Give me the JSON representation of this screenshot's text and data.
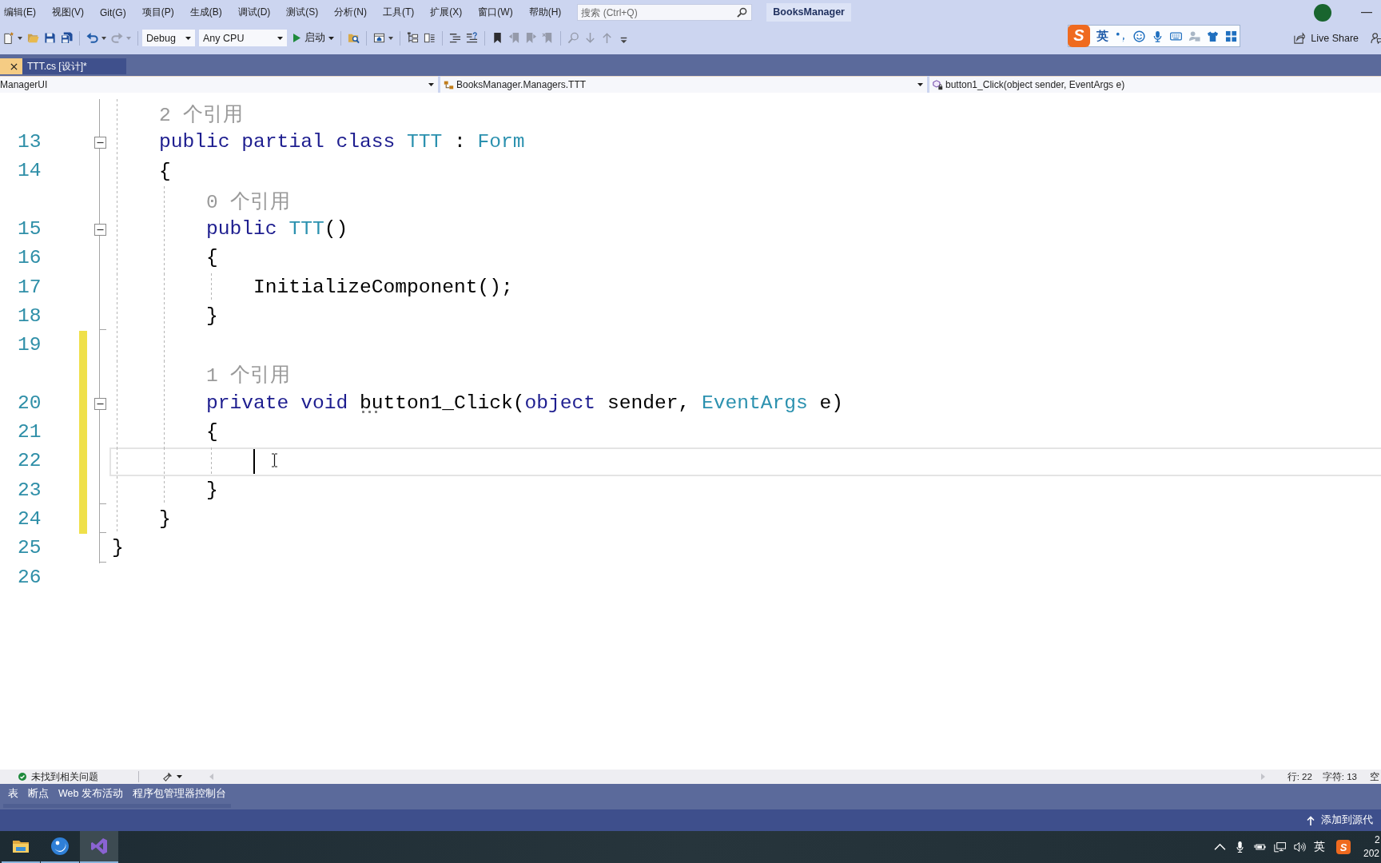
{
  "menu_bar": {
    "items": [
      "编辑(E)",
      "视图(V)",
      "Git(G)",
      "项目(P)",
      "生成(B)",
      "调试(D)",
      "测试(S)",
      "分析(N)",
      "工具(T)",
      "扩展(X)",
      "窗口(W)",
      "帮助(H)"
    ],
    "search": {
      "placeholder": "搜索 (Ctrl+Q)"
    },
    "solution": "BooksManager"
  },
  "toolbar": {
    "groups": [
      [
        {
          "kind": "new",
          "disabled": false
        },
        {
          "kind": "open",
          "disabled": false
        },
        {
          "kind": "save",
          "disabled": false
        },
        {
          "kind": "save_all",
          "disabled": false
        }
      ],
      [
        {
          "kind": "undo",
          "disabled": false
        },
        {
          "kind": "redo",
          "disabled": true
        }
      ],
      [
        {
          "kind": "configuration",
          "value": "Debug"
        },
        {
          "kind": "platform",
          "value": "Any CPU"
        },
        {
          "kind": "start",
          "label": "启动"
        }
      ],
      [
        {
          "kind": "find_in_files",
          "disabled": false
        }
      ],
      [
        {
          "kind": "window",
          "disabled": false
        }
      ],
      [
        {
          "kind": "outline",
          "disabled": false
        },
        {
          "kind": "columns",
          "disabled": false
        }
      ],
      [
        {
          "kind": "comment",
          "disabled": false
        },
        {
          "kind": "uncomment",
          "disabled": false
        }
      ],
      [
        {
          "kind": "bookmark",
          "disabled": false
        },
        {
          "kind": "previous_bookmark",
          "disabled": true
        },
        {
          "kind": "next_bookmark",
          "disabled": true
        },
        {
          "kind": "clear_bookmarks",
          "disabled": true
        }
      ],
      [
        {
          "kind": "find_references",
          "disabled": true
        },
        {
          "kind": "move_down",
          "disabled": true
        },
        {
          "kind": "move_up",
          "disabled": true
        },
        {
          "kind": "overflow",
          "disabled": false
        }
      ]
    ],
    "live_share": "Live Share"
  },
  "ime_toolbar": {
    "logo": "S",
    "mode": "英"
  },
  "tabs": [
    {
      "selected": true
    },
    {
      "label": "TTT.cs [设计]*",
      "selected": false
    }
  ],
  "navigation_bar": {
    "project": "ManagerUI",
    "type": "BooksManager.Managers.TTT",
    "member": "button1_Click(object sender, EventArgs e)"
  },
  "editor": {
    "rows": [
      {
        "kind": "block",
        "children": [
          {
            "kind": "lens",
            "text": "2 个引用",
            "changed": false
          },
          {
            "kind": "code",
            "number": "13",
            "collapsible": true,
            "changed": false,
            "current": false,
            "tokens": [
              {
                "kind": "keyword",
                "text": "public "
              },
              {
                "kind": "keyword",
                "text": "partial "
              },
              {
                "kind": "keyword",
                "text": "class "
              },
              {
                "kind": "type",
                "text": "TTT"
              },
              {
                "kind": "plain",
                "text": " : "
              },
              {
                "kind": "type",
                "text": "Form"
              }
            ]
          },
          {
            "kind": "code",
            "number": "14",
            "collapsible": false,
            "changed": false,
            "current": false,
            "tokens": [
              {
                "kind": "plain",
                "text": "{"
              }
            ]
          },
          {
            "kind": "block",
            "children": [
              {
                "kind": "lens",
                "text": "0 个引用",
                "changed": false
              },
              {
                "kind": "code",
                "number": "15",
                "collapsible": true,
                "changed": false,
                "current": false,
                "tokens": [
                  {
                    "kind": "keyword",
                    "text": "public "
                  },
                  {
                    "kind": "type",
                    "text": "TTT"
                  },
                  {
                    "kind": "plain",
                    "text": "()"
                  }
                ]
              },
              {
                "kind": "code",
                "number": "16",
                "collapsible": false,
                "changed": false,
                "current": false,
                "tokens": [
                  {
                    "kind": "plain",
                    "text": "{"
                  }
                ]
              },
              {
                "kind": "block",
                "children": [
                  {
                    "kind": "code",
                    "number": "17",
                    "collapsible": false,
                    "changed": false,
                    "current": false,
                    "tokens": [
                      {
                        "kind": "plain",
                        "text": "InitializeComponent();"
                      }
                    ]
                  }
                ]
              },
              {
                "kind": "code",
                "number": "18",
                "collapsible": false,
                "changed": false,
                "current": false,
                "tokens": [
                  {
                    "kind": "plain",
                    "text": "}"
                  }
                ]
              },
              {
                "kind": "code",
                "number": "19",
                "collapsible": false,
                "changed": true,
                "current": false
              },
              {
                "kind": "lens",
                "text": "1 个引用",
                "changed": true
              },
              {
                "kind": "code",
                "number": "20",
                "collapsible": true,
                "changed": true,
                "current": false,
                "tokens": [
                  {
                    "kind": "keyword",
                    "text": "private "
                  },
                  {
                    "kind": "keyword",
                    "text": "void "
                  },
                  {
                    "kind": "plain",
                    "text": "button1_Click",
                    "hint": true
                  },
                  {
                    "kind": "plain",
                    "text": "("
                  },
                  {
                    "kind": "keyword",
                    "text": "object "
                  },
                  {
                    "kind": "plain",
                    "text": "sender, "
                  },
                  {
                    "kind": "type",
                    "text": "EventArgs "
                  },
                  {
                    "kind": "plain",
                    "text": "e)"
                  }
                ]
              },
              {
                "kind": "code",
                "number": "21",
                "collapsible": false,
                "changed": true,
                "current": false,
                "tokens": [
                  {
                    "kind": "plain",
                    "text": "{"
                  }
                ]
              },
              {
                "kind": "block",
                "children": [
                  {
                    "kind": "code",
                    "number": "22",
                    "collapsible": false,
                    "changed": true,
                    "current": true
                  }
                ]
              },
              {
                "kind": "code",
                "number": "23",
                "collapsible": false,
                "changed": true,
                "current": false,
                "tokens": [
                  {
                    "kind": "plain",
                    "text": "}"
                  }
                ]
              }
            ]
          },
          {
            "kind": "code",
            "number": "24",
            "collapsible": false,
            "changed": true,
            "current": false,
            "tokens": [
              {
                "kind": "plain",
                "text": "}"
              }
            ]
          }
        ]
      },
      {
        "kind": "code",
        "number": "25",
        "collapsible": false,
        "changed": false,
        "current": false,
        "tokens": [
          {
            "kind": "plain",
            "text": "}"
          }
        ]
      },
      {
        "kind": "code",
        "number": "26",
        "collapsible": false,
        "changed": false,
        "current": false
      }
    ]
  },
  "editor_status": {
    "issues": "未找到相关问题",
    "line": "行: 22",
    "column": "字符: 13",
    "indent": "空"
  },
  "tool_tabs": [
    "表",
    "断点",
    "Web 发布活动",
    "程序包管理器控制台"
  ],
  "status_bar": {
    "source_control": "添加到源代"
  },
  "taskbar": {
    "apps": [
      {
        "kind": "files",
        "selected": false
      },
      {
        "kind": "browser",
        "selected": false
      },
      {
        "kind": "visual_studio",
        "selected": true
      }
    ],
    "tray": {
      "ime": "英",
      "ime_logo": "S",
      "clock": [
        "2",
        "202"
      ]
    }
  }
}
